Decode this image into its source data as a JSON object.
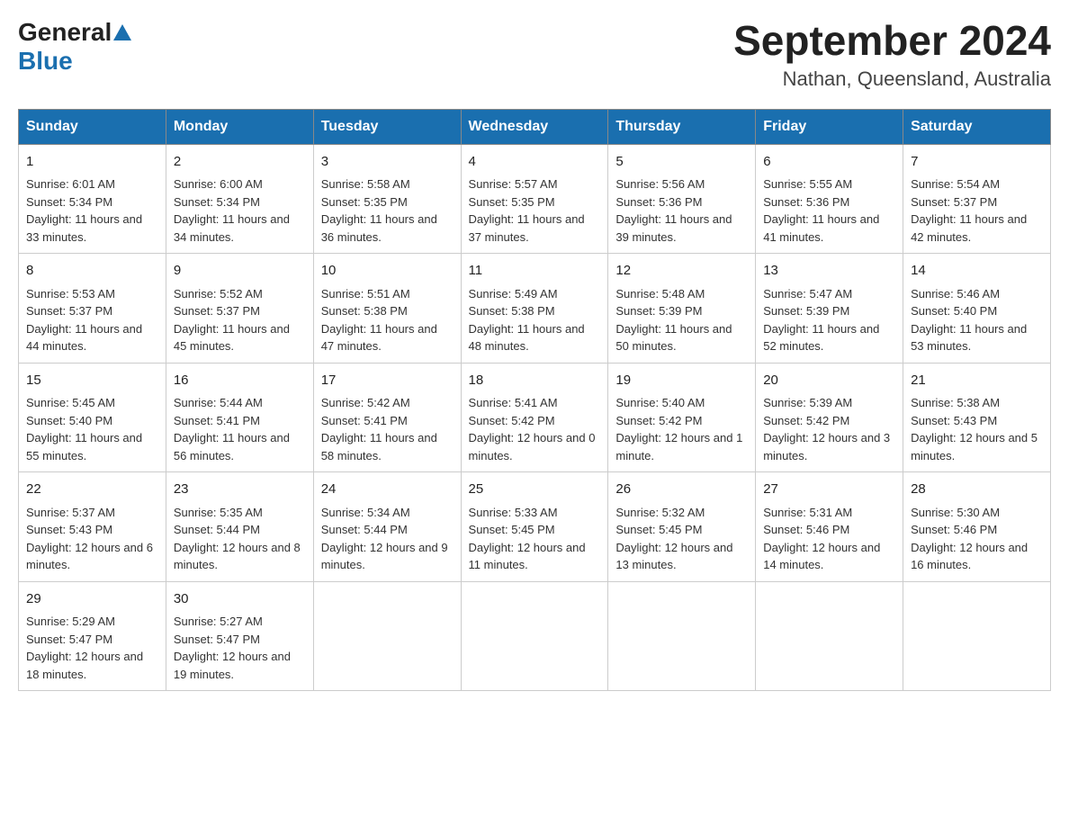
{
  "header": {
    "logo_general": "General",
    "logo_blue": "Blue",
    "month_year": "September 2024",
    "location": "Nathan, Queensland, Australia"
  },
  "weekdays": [
    "Sunday",
    "Monday",
    "Tuesday",
    "Wednesday",
    "Thursday",
    "Friday",
    "Saturday"
  ],
  "weeks": [
    [
      {
        "day": "1",
        "sunrise": "6:01 AM",
        "sunset": "5:34 PM",
        "daylight": "11 hours and 33 minutes."
      },
      {
        "day": "2",
        "sunrise": "6:00 AM",
        "sunset": "5:34 PM",
        "daylight": "11 hours and 34 minutes."
      },
      {
        "day": "3",
        "sunrise": "5:58 AM",
        "sunset": "5:35 PM",
        "daylight": "11 hours and 36 minutes."
      },
      {
        "day": "4",
        "sunrise": "5:57 AM",
        "sunset": "5:35 PM",
        "daylight": "11 hours and 37 minutes."
      },
      {
        "day": "5",
        "sunrise": "5:56 AM",
        "sunset": "5:36 PM",
        "daylight": "11 hours and 39 minutes."
      },
      {
        "day": "6",
        "sunrise": "5:55 AM",
        "sunset": "5:36 PM",
        "daylight": "11 hours and 41 minutes."
      },
      {
        "day": "7",
        "sunrise": "5:54 AM",
        "sunset": "5:37 PM",
        "daylight": "11 hours and 42 minutes."
      }
    ],
    [
      {
        "day": "8",
        "sunrise": "5:53 AM",
        "sunset": "5:37 PM",
        "daylight": "11 hours and 44 minutes."
      },
      {
        "day": "9",
        "sunrise": "5:52 AM",
        "sunset": "5:37 PM",
        "daylight": "11 hours and 45 minutes."
      },
      {
        "day": "10",
        "sunrise": "5:51 AM",
        "sunset": "5:38 PM",
        "daylight": "11 hours and 47 minutes."
      },
      {
        "day": "11",
        "sunrise": "5:49 AM",
        "sunset": "5:38 PM",
        "daylight": "11 hours and 48 minutes."
      },
      {
        "day": "12",
        "sunrise": "5:48 AM",
        "sunset": "5:39 PM",
        "daylight": "11 hours and 50 minutes."
      },
      {
        "day": "13",
        "sunrise": "5:47 AM",
        "sunset": "5:39 PM",
        "daylight": "11 hours and 52 minutes."
      },
      {
        "day": "14",
        "sunrise": "5:46 AM",
        "sunset": "5:40 PM",
        "daylight": "11 hours and 53 minutes."
      }
    ],
    [
      {
        "day": "15",
        "sunrise": "5:45 AM",
        "sunset": "5:40 PM",
        "daylight": "11 hours and 55 minutes."
      },
      {
        "day": "16",
        "sunrise": "5:44 AM",
        "sunset": "5:41 PM",
        "daylight": "11 hours and 56 minutes."
      },
      {
        "day": "17",
        "sunrise": "5:42 AM",
        "sunset": "5:41 PM",
        "daylight": "11 hours and 58 minutes."
      },
      {
        "day": "18",
        "sunrise": "5:41 AM",
        "sunset": "5:42 PM",
        "daylight": "12 hours and 0 minutes."
      },
      {
        "day": "19",
        "sunrise": "5:40 AM",
        "sunset": "5:42 PM",
        "daylight": "12 hours and 1 minute."
      },
      {
        "day": "20",
        "sunrise": "5:39 AM",
        "sunset": "5:42 PM",
        "daylight": "12 hours and 3 minutes."
      },
      {
        "day": "21",
        "sunrise": "5:38 AM",
        "sunset": "5:43 PM",
        "daylight": "12 hours and 5 minutes."
      }
    ],
    [
      {
        "day": "22",
        "sunrise": "5:37 AM",
        "sunset": "5:43 PM",
        "daylight": "12 hours and 6 minutes."
      },
      {
        "day": "23",
        "sunrise": "5:35 AM",
        "sunset": "5:44 PM",
        "daylight": "12 hours and 8 minutes."
      },
      {
        "day": "24",
        "sunrise": "5:34 AM",
        "sunset": "5:44 PM",
        "daylight": "12 hours and 9 minutes."
      },
      {
        "day": "25",
        "sunrise": "5:33 AM",
        "sunset": "5:45 PM",
        "daylight": "12 hours and 11 minutes."
      },
      {
        "day": "26",
        "sunrise": "5:32 AM",
        "sunset": "5:45 PM",
        "daylight": "12 hours and 13 minutes."
      },
      {
        "day": "27",
        "sunrise": "5:31 AM",
        "sunset": "5:46 PM",
        "daylight": "12 hours and 14 minutes."
      },
      {
        "day": "28",
        "sunrise": "5:30 AM",
        "sunset": "5:46 PM",
        "daylight": "12 hours and 16 minutes."
      }
    ],
    [
      {
        "day": "29",
        "sunrise": "5:29 AM",
        "sunset": "5:47 PM",
        "daylight": "12 hours and 18 minutes."
      },
      {
        "day": "30",
        "sunrise": "5:27 AM",
        "sunset": "5:47 PM",
        "daylight": "12 hours and 19 minutes."
      },
      null,
      null,
      null,
      null,
      null
    ]
  ],
  "labels": {
    "sunrise": "Sunrise:",
    "sunset": "Sunset:",
    "daylight": "Daylight:"
  }
}
